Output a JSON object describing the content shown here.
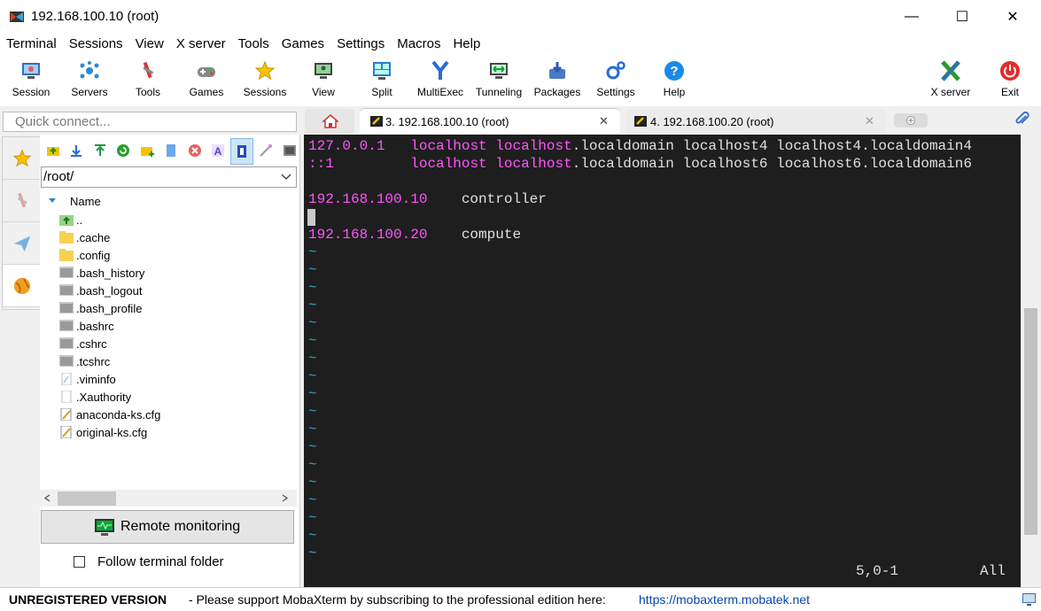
{
  "window": {
    "title": "192.168.100.10 (root)",
    "minimize": "—",
    "maximize": "☐",
    "close": "✕"
  },
  "menu": [
    "Terminal",
    "Sessions",
    "View",
    "X server",
    "Tools",
    "Games",
    "Settings",
    "Macros",
    "Help"
  ],
  "toolbar": {
    "session": "Session",
    "servers": "Servers",
    "tools": "Tools",
    "games": "Games",
    "sessions": "Sessions",
    "view": "View",
    "split": "Split",
    "multiexec": "MultiExec",
    "tunneling": "Tunneling",
    "packages": "Packages",
    "settings": "Settings",
    "help": "Help",
    "xserver": "X server",
    "exit": "Exit"
  },
  "quick_connect": {
    "placeholder": "Quick connect..."
  },
  "tabs": [
    {
      "label": "3. 192.168.100.10 (root)",
      "close": "✕"
    },
    {
      "label": "4. 192.168.100.20 (root)",
      "close": "✕"
    }
  ],
  "sftp": {
    "path": "/root/",
    "column_name": "Name",
    "files": [
      "..",
      ".cache",
      ".config",
      ".bash_history",
      ".bash_logout",
      ".bash_profile",
      ".bashrc",
      ".cshrc",
      ".tcshrc",
      ".viminfo",
      ".Xauthority",
      "anaconda-ks.cfg",
      "original-ks.cfg"
    ],
    "remote_monitoring": "Remote monitoring",
    "follow_terminal_folder": "Follow terminal folder"
  },
  "terminal": {
    "line1": {
      "ip": "127.0.0.1",
      "h1": "localhost",
      "h2": "localhost",
      "rest": ".localdomain localhost4 localhost4.localdomain4"
    },
    "line2": {
      "ip": "::1",
      "h1": "localhost",
      "h2": "localhost",
      "rest": ".localdomain localhost6 localhost6.localdomain6"
    },
    "line3": {
      "ip": "192.168.100.10",
      "name": "controller"
    },
    "line4": {
      "ip": "192.168.100.20",
      "name": "compute"
    },
    "tilde": "~",
    "position": "5,0-1",
    "scroll": "All"
  },
  "status": {
    "unregistered": "UNREGISTERED VERSION",
    "message": "-  Please support MobaXterm by subscribing to the professional edition here:",
    "link": "https://mobaxterm.mobatek.net"
  },
  "colors": {
    "accent": "#0078d7",
    "terminal_bg": "#1e1e1e",
    "magenta": "#ff55ff",
    "tilde": "#28a5c8"
  }
}
